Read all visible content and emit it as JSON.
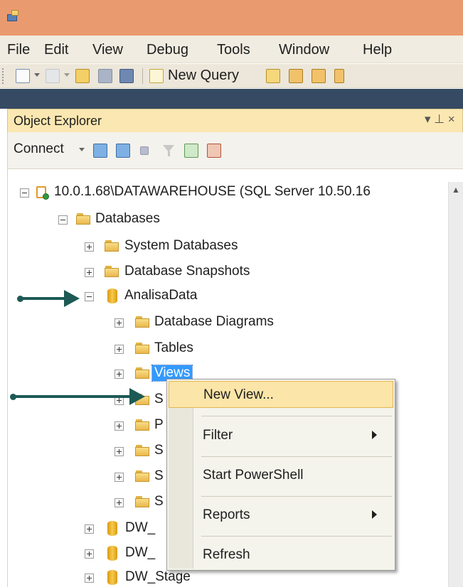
{
  "menubar": {
    "items": [
      "File",
      "Edit",
      "View",
      "Debug",
      "Tools",
      "Window",
      "Help"
    ]
  },
  "toolbar": {
    "new_query_label": "New Query"
  },
  "object_explorer": {
    "title": "Object Explorer",
    "controls": "▾ ⊥ ×",
    "connect_label": "Connect"
  },
  "tree": {
    "server": "10.0.1.68\\DATAWAREHOUSE (SQL Server 10.50.16",
    "databases": "Databases",
    "system_databases": "System Databases",
    "database_snapshots": "Database Snapshots",
    "analisadata": "AnalisaData",
    "database_diagrams": "Database Diagrams",
    "tables": "Tables",
    "views": "Views",
    "hidden_folders": [
      "S",
      "P",
      "S",
      "S",
      "S"
    ],
    "dw_1": "DW_",
    "dw_2": "DW_",
    "dw_stage": "DW_Stage"
  },
  "context_menu": {
    "items": [
      {
        "label": "New View...",
        "highlighted": true,
        "submenu": false
      },
      {
        "label": "Filter",
        "highlighted": false,
        "submenu": true
      },
      {
        "label": "Start PowerShell",
        "highlighted": false,
        "submenu": false
      },
      {
        "label": "Reports",
        "highlighted": false,
        "submenu": true
      },
      {
        "label": "Refresh",
        "highlighted": false,
        "submenu": false
      }
    ]
  },
  "colors": {
    "titlebar": "#ea9a6f",
    "selection": "#3399ff",
    "annotation_arrow": "#1d5a55",
    "menu_highlight": "#fbe5a8"
  }
}
